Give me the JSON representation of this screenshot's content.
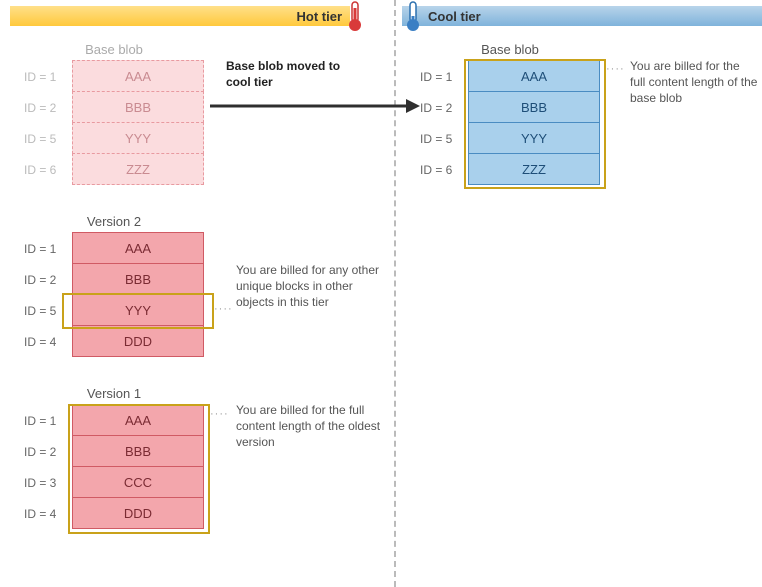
{
  "hot_tier_label": "Hot tier",
  "cool_tier_label": "Cool tier",
  "move_label": "Base blob moved to cool tier",
  "anno_v2": "You are billed for any other unique blocks in other objects in this tier",
  "anno_v1": "You are billed for the full content length of the oldest version",
  "anno_cool": "You are billed for the full content length of the base blob",
  "tables": {
    "ghost": {
      "title": "Base blob",
      "rows": [
        {
          "id": "ID = 1",
          "val": "AAA"
        },
        {
          "id": "ID = 2",
          "val": "BBB"
        },
        {
          "id": "ID = 5",
          "val": "YYY"
        },
        {
          "id": "ID = 6",
          "val": "ZZZ"
        }
      ]
    },
    "v2": {
      "title": "Version 2",
      "rows": [
        {
          "id": "ID = 1",
          "val": "AAA"
        },
        {
          "id": "ID = 2",
          "val": "BBB"
        },
        {
          "id": "ID = 5",
          "val": "YYY"
        },
        {
          "id": "ID = 4",
          "val": "DDD"
        }
      ]
    },
    "v1": {
      "title": "Version 1",
      "rows": [
        {
          "id": "ID = 1",
          "val": "AAA"
        },
        {
          "id": "ID = 2",
          "val": "BBB"
        },
        {
          "id": "ID = 3",
          "val": "CCC"
        },
        {
          "id": "ID = 4",
          "val": "DDD"
        }
      ]
    },
    "cool": {
      "title": "Base blob",
      "rows": [
        {
          "id": "ID = 1",
          "val": "AAA"
        },
        {
          "id": "ID = 2",
          "val": "BBB"
        },
        {
          "id": "ID = 5",
          "val": "YYY"
        },
        {
          "id": "ID = 6",
          "val": "ZZZ"
        }
      ]
    }
  }
}
